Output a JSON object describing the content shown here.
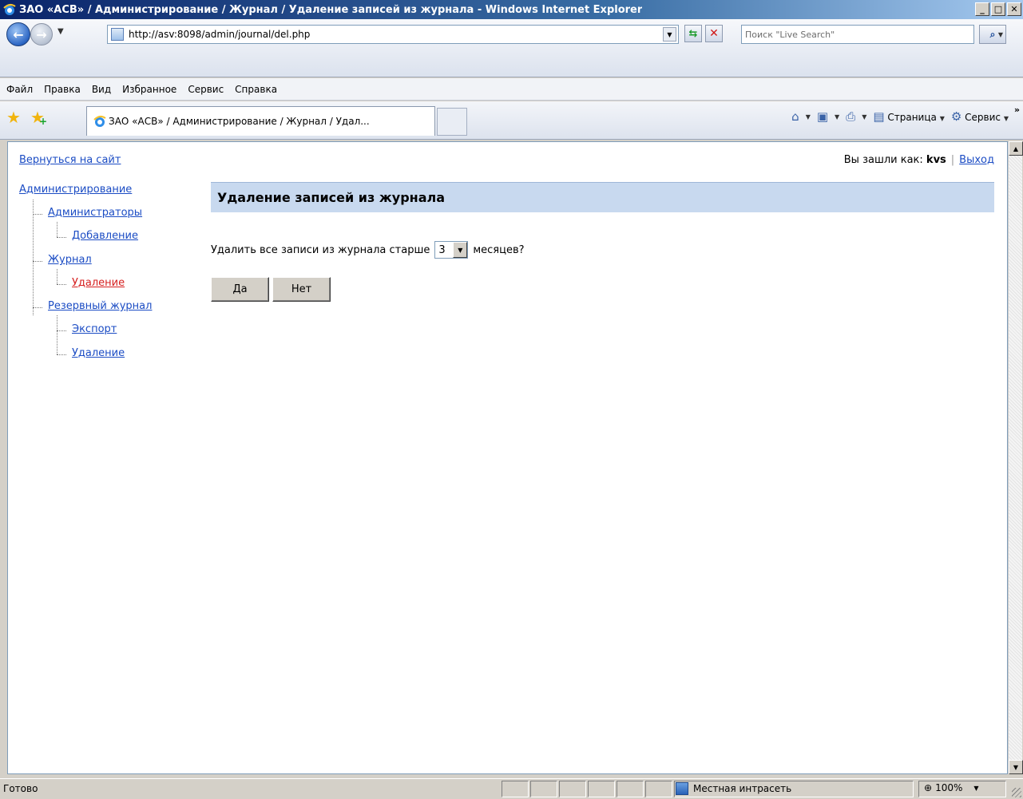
{
  "window": {
    "title": "ЗАО «АСВ» / Администрирование / Журнал / Удаление записей из журнала - Windows Internet Explorer",
    "minimize": "_",
    "maximize": "□",
    "close": "✕"
  },
  "addressbar": {
    "url": "http://asv:8098/admin/journal/del.php",
    "search_placeholder": "Поиск \"Live Search\""
  },
  "menu": [
    "Файл",
    "Правка",
    "Вид",
    "Избранное",
    "Сервис",
    "Справка"
  ],
  "tab": {
    "title": "ЗАО «АСВ» / Администрирование / Журнал / Удал..."
  },
  "commandbar": {
    "page_label": "Страница",
    "tools_label": "Сервис"
  },
  "page": {
    "back_link": "Вернуться на сайт",
    "logged_in_label": "Вы зашли как:",
    "username": "kvs",
    "separator": "|",
    "logout": "Выход",
    "tree": {
      "root": "Администрирование",
      "admins": "Администраторы",
      "admins_add": "Добавление",
      "journal": "Журнал",
      "journal_delete": "Удаление",
      "backup": "Резервный журнал",
      "backup_export": "Экспорт",
      "backup_delete": "Удаление"
    },
    "heading": "Удаление записей из журнала",
    "question_prefix": "Удалить все записи из журнала старше",
    "months_value": "3",
    "question_suffix": "месяцев?",
    "yes_button": "Да",
    "no_button": "Нет"
  },
  "statusbar": {
    "status": "Готово",
    "zone": "Местная интрасеть",
    "zoom": "100%"
  }
}
